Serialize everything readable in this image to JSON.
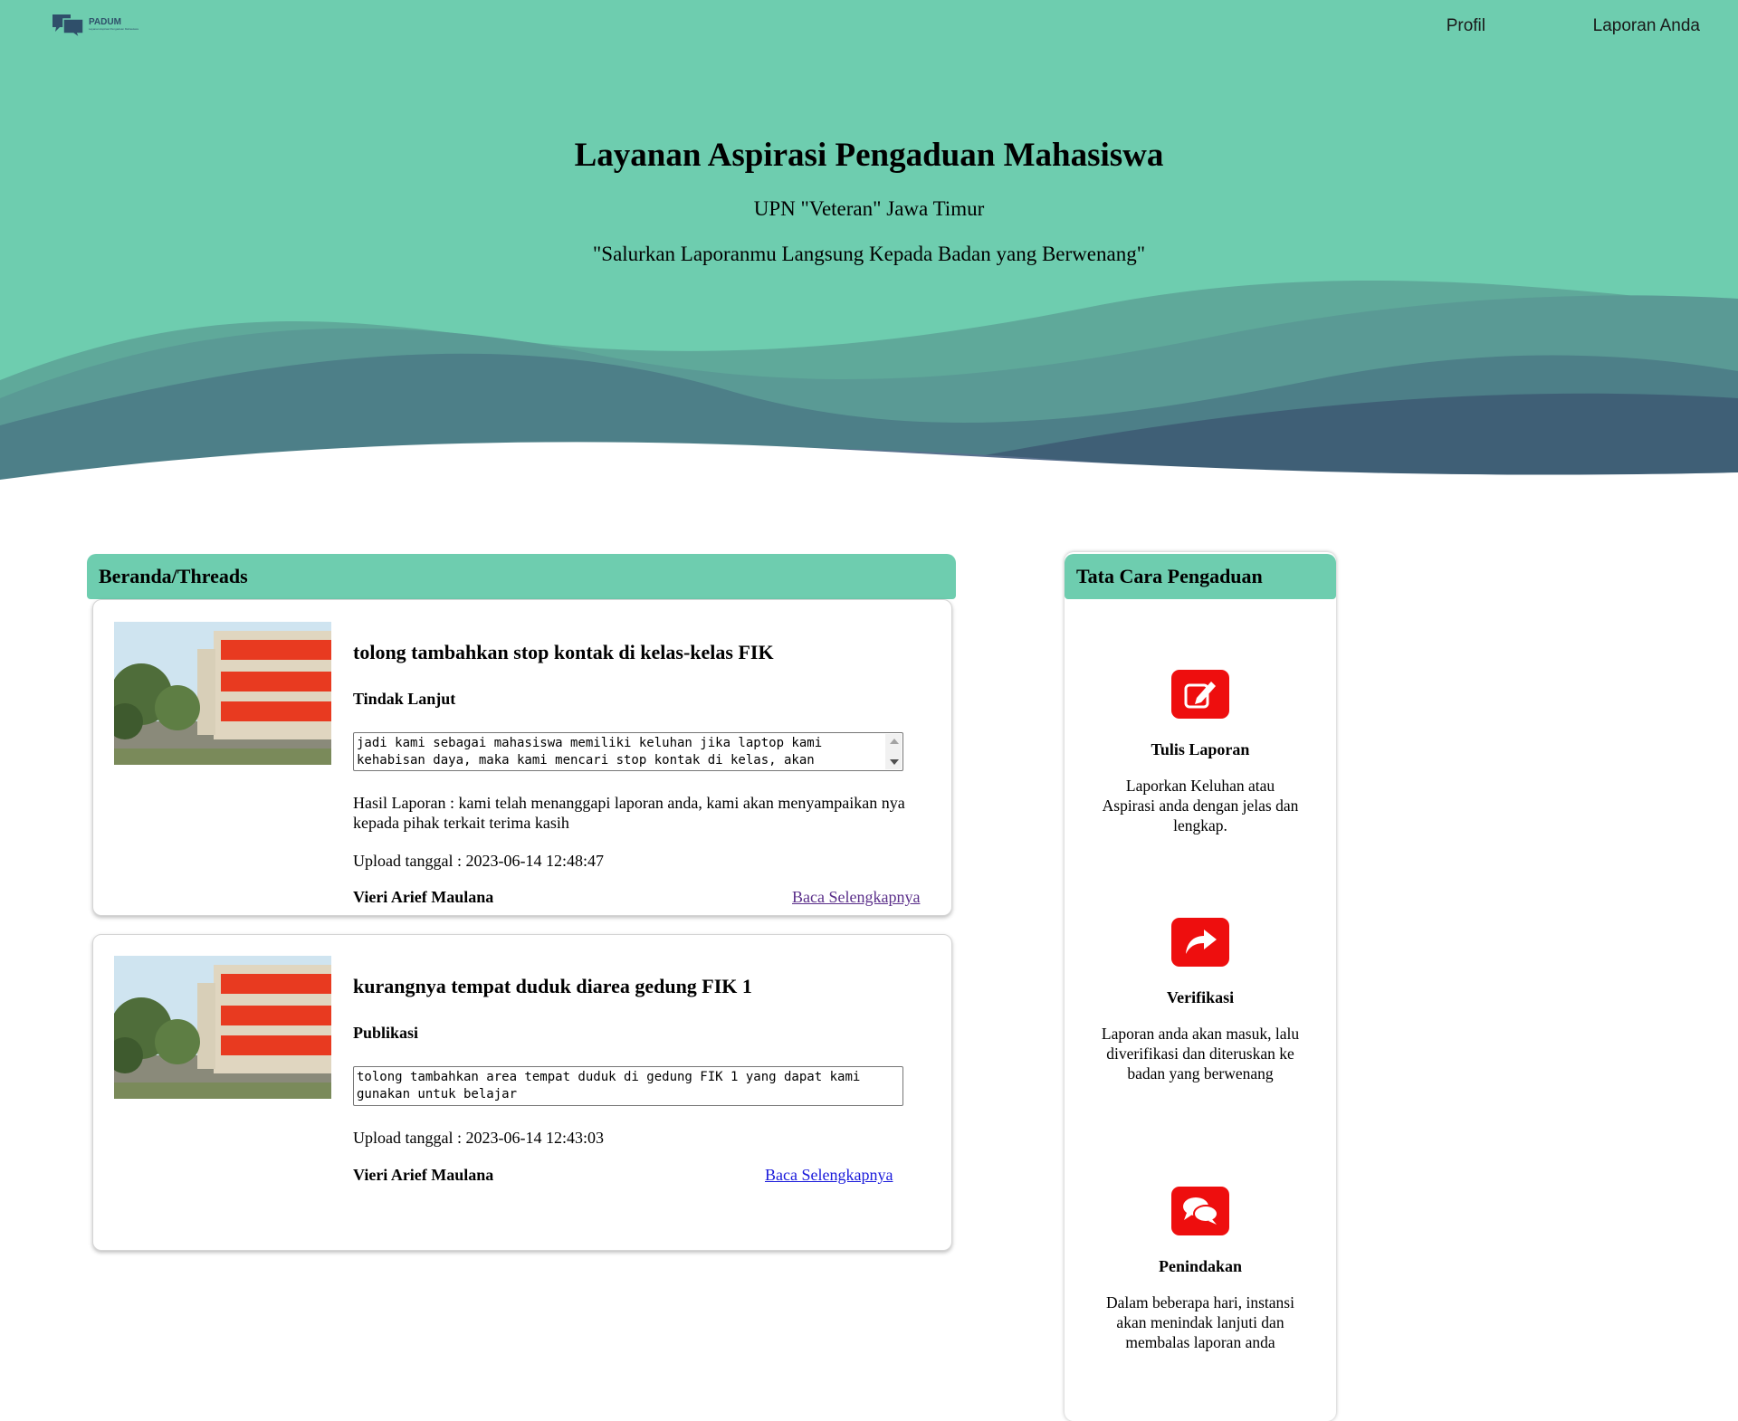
{
  "header": {
    "logo": {
      "icon": "chat-bubbles-icon",
      "text": "PADUM",
      "subtext": "Layanan Aspirasi Pengaduan Mahasiswa"
    },
    "nav": [
      {
        "label": "Profil"
      },
      {
        "label": "Laporan Anda"
      }
    ]
  },
  "hero": {
    "title": "Layanan Aspirasi Pengaduan Mahasiswa",
    "subtitle": "UPN \"Veteran\" Jawa Timur",
    "tagline": "\"Salurkan Laporanmu Langsung Kepada Badan yang Berwenang\""
  },
  "threads": {
    "header": "Beranda/Threads",
    "posts": [
      {
        "title": "tolong tambahkan stop kontak di kelas-kelas FIK",
        "status": "Tindak Lanjut",
        "body": "jadi kami sebagai mahasiswa memiliki keluhan jika laptop kami kehabisan daya, maka kami mencari stop kontak di kelas, akan",
        "result": "Hasil Laporan : kami telah menanggapi laporan anda, kami akan menyampaikan nya kepada pihak terkait terima kasih",
        "uploaded": "Upload tanggal : 2023-06-14 12:48:47",
        "author": "Vieri Arief Maulana",
        "link": "Baca Selengkapnya"
      },
      {
        "title": "kurangnya tempat duduk diarea gedung FIK 1",
        "status": "Publikasi",
        "body": "tolong tambahkan area tempat duduk di gedung FIK 1 yang dapat kami gunakan untuk belajar",
        "uploaded": "Upload tanggal : 2023-06-14 12:43:03",
        "author": "Vieri Arief Maulana",
        "link": "Baca Selengkapnya"
      }
    ]
  },
  "guide": {
    "header": "Tata Cara Pengaduan",
    "steps": [
      {
        "icon": "edit-icon",
        "title": "Tulis Laporan",
        "desc": "Laporkan Keluhan atau Aspirasi anda dengan jelas dan lengkap."
      },
      {
        "icon": "share-arrow-icon",
        "title": "Verifikasi",
        "desc": "Laporan anda akan masuk, lalu diverifikasi dan diteruskan ke badan yang berwenang"
      },
      {
        "icon": "chat-icon",
        "title": "Penindakan",
        "desc": "Dalam beberapa hari, instansi akan menindak lanjuti dan membalas laporan anda"
      }
    ]
  },
  "colors": {
    "accent": "#6ecdaf",
    "wave_dark": "#46707f",
    "icon_bg": "#ee0e0e"
  }
}
